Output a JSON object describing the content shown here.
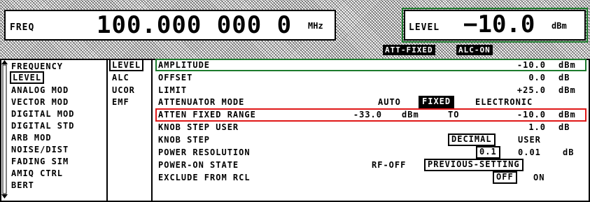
{
  "header": {
    "freq_label": "FREQ",
    "freq_value": "100.000 000 0",
    "freq_unit": "MHz",
    "level_label": "LEVEL",
    "level_value": "−10.0",
    "level_unit": "dBm"
  },
  "status": {
    "att": "ATT-FIXED",
    "alc": "ALC-ON"
  },
  "main_menu": [
    "FREQUENCY",
    "LEVEL",
    "ANALOG MOD",
    "VECTOR MOD",
    "DIGITAL MOD",
    "DIGITAL STD",
    "ARB MOD",
    "NOISE/DIST",
    "FADING SIM",
    "AMIQ CTRL",
    "BERT"
  ],
  "sub_menu": [
    "LEVEL",
    "ALC",
    "UCOR",
    "EMF"
  ],
  "params": {
    "amplitude": {
      "label": "AMPLITUDE",
      "value": "-10.0",
      "unit": "dBm"
    },
    "offset": {
      "label": "OFFSET",
      "value": "0.0",
      "unit": "dB"
    },
    "limit": {
      "label": "LIMIT",
      "value": "+25.0",
      "unit": "dBm"
    },
    "attenuator_mode": {
      "label": "ATTENUATOR MODE",
      "options": [
        "AUTO",
        "FIXED",
        "ELECTRONIC"
      ]
    },
    "atten_fixed_range": {
      "label": "ATTEN FIXED RANGE",
      "from_value": "-33.0",
      "from_unit": "dBm",
      "to_label": "TO",
      "to_value": "-10.0",
      "to_unit": "dBm"
    },
    "knob_step_user": {
      "label": "KNOB STEP USER",
      "value": "1.0",
      "unit": "dB"
    },
    "knob_step": {
      "label": "KNOB STEP",
      "options": [
        "DECIMAL",
        "USER"
      ]
    },
    "power_resolution": {
      "label": "POWER RESOLUTION",
      "options": [
        "0.1",
        "0.01"
      ],
      "unit": "dB"
    },
    "power_on_state": {
      "label": "POWER-ON STATE",
      "options": [
        "RF-OFF",
        "PREVIOUS-SETTING"
      ]
    },
    "exclude_from_rcl": {
      "label": "EXCLUDE FROM RCL",
      "options": [
        "OFF",
        "ON"
      ]
    }
  },
  "colors": {
    "highlight_green": "#1c7a2c",
    "highlight_red": "#e01818"
  }
}
